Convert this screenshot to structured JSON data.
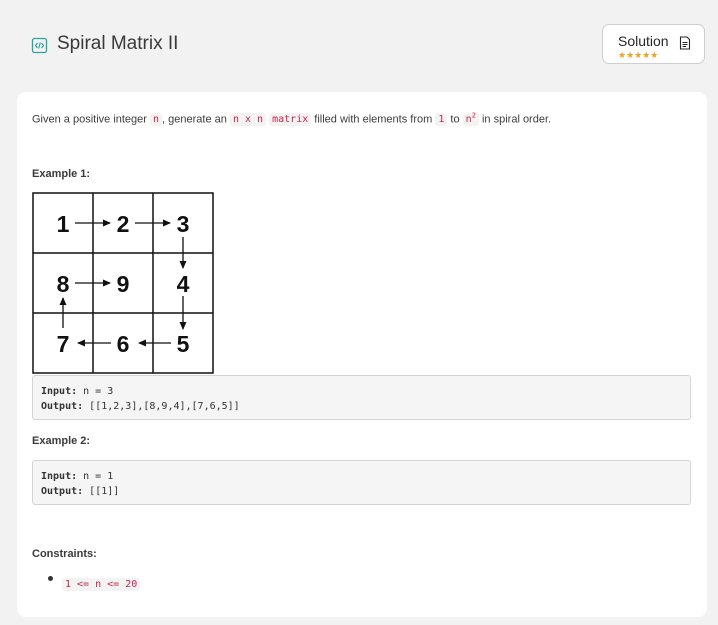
{
  "problem": {
    "title": "Spiral Matrix II"
  },
  "solution_button": {
    "label": "Solution",
    "stars": "★★★★★"
  },
  "description": {
    "p1": "Given a positive integer ",
    "c1": "n",
    "p2": ", generate an ",
    "c2": "n x n",
    "p3": " ",
    "c3": "matrix",
    "p4": " filled with elements from ",
    "c4": "1",
    "p5": " to ",
    "c5": "n",
    "c5_sup": "2",
    "p6": " in spiral order."
  },
  "example1": {
    "label": "Example 1:",
    "matrix": [
      "1",
      "2",
      "3",
      "8",
      "9",
      "4",
      "7",
      "6",
      "5"
    ],
    "input_key": "Input:",
    "input_value": " n = 3",
    "output_key": "Output:",
    "output_value": " [[1,2,3],[8,9,4],[7,6,5]]"
  },
  "example2": {
    "label": "Example 2:",
    "input_key": "Input:",
    "input_value": " n = 1",
    "output_key": "Output:",
    "output_value": " [[1]]"
  },
  "constraints": {
    "label": "Constraints:",
    "items": [
      "1 <= n <= 20"
    ]
  },
  "colors": {
    "accent_icon": "#2aa39a",
    "code_text": "#c7254e",
    "stars": "#f0a020"
  }
}
